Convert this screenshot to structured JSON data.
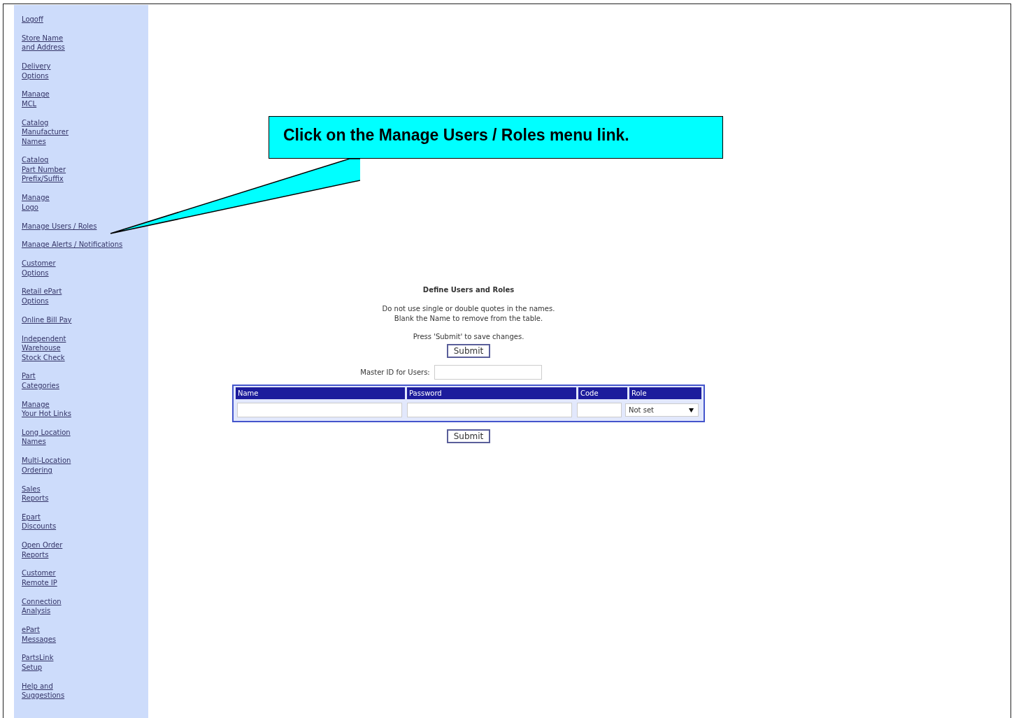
{
  "sidebar": {
    "items": [
      {
        "lines": [
          "Logoff"
        ]
      },
      {
        "lines": [
          "Store Name",
          "and Address"
        ]
      },
      {
        "lines": [
          "Delivery",
          "Options"
        ]
      },
      {
        "lines": [
          "Manage",
          "MCL"
        ]
      },
      {
        "lines": [
          "Catalog",
          "Manufacturer",
          "Names"
        ]
      },
      {
        "lines": [
          "Catalog",
          "Part Number",
          "Prefix/Suffix"
        ]
      },
      {
        "lines": [
          "Manage",
          "Logo"
        ]
      },
      {
        "lines": [
          "Manage Users / Roles"
        ]
      },
      {
        "lines": [
          "Manage Alerts / Notifications"
        ]
      },
      {
        "lines": [
          "Customer",
          "Options"
        ]
      },
      {
        "lines": [
          "Retail ePart",
          "Options"
        ]
      },
      {
        "lines": [
          "Online Bill Pay"
        ]
      },
      {
        "lines": [
          "Independent",
          "Warehouse",
          "Stock Check"
        ]
      },
      {
        "lines": [
          "Part",
          "Categories"
        ]
      },
      {
        "lines": [
          "Manage",
          "Your Hot Links"
        ]
      },
      {
        "lines": [
          "Long Location",
          "Names"
        ]
      },
      {
        "lines": [
          "Multi-Location",
          "Ordering"
        ]
      },
      {
        "lines": [
          "Sales",
          "Reports"
        ]
      },
      {
        "lines": [
          "Epart",
          "Discounts"
        ]
      },
      {
        "lines": [
          "Open Order",
          "Reports"
        ]
      },
      {
        "lines": [
          "Customer",
          "Remote IP"
        ]
      },
      {
        "lines": [
          "Connection",
          "Analysis"
        ]
      },
      {
        "lines": [
          "ePart",
          "Messages"
        ]
      },
      {
        "lines": [
          "PartsLink",
          "Setup"
        ]
      },
      {
        "lines": [
          "Help and",
          "Suggestions"
        ]
      }
    ]
  },
  "callout": {
    "text": "Click on the Manage Users / Roles menu link."
  },
  "form": {
    "title": "Define Users and Roles",
    "notes": [
      "Do not use single or double quotes in the names.",
      "Blank the Name to remove from the table."
    ],
    "press_note": "Press 'Submit' to save changes.",
    "submit_top": "Submit",
    "master_id_label": "Master ID for Users:",
    "table": {
      "columns": [
        "Name",
        "Password",
        "Code",
        "Role"
      ],
      "rows": [
        {
          "role": "Not set"
        }
      ]
    },
    "submit_bottom": "Submit"
  }
}
